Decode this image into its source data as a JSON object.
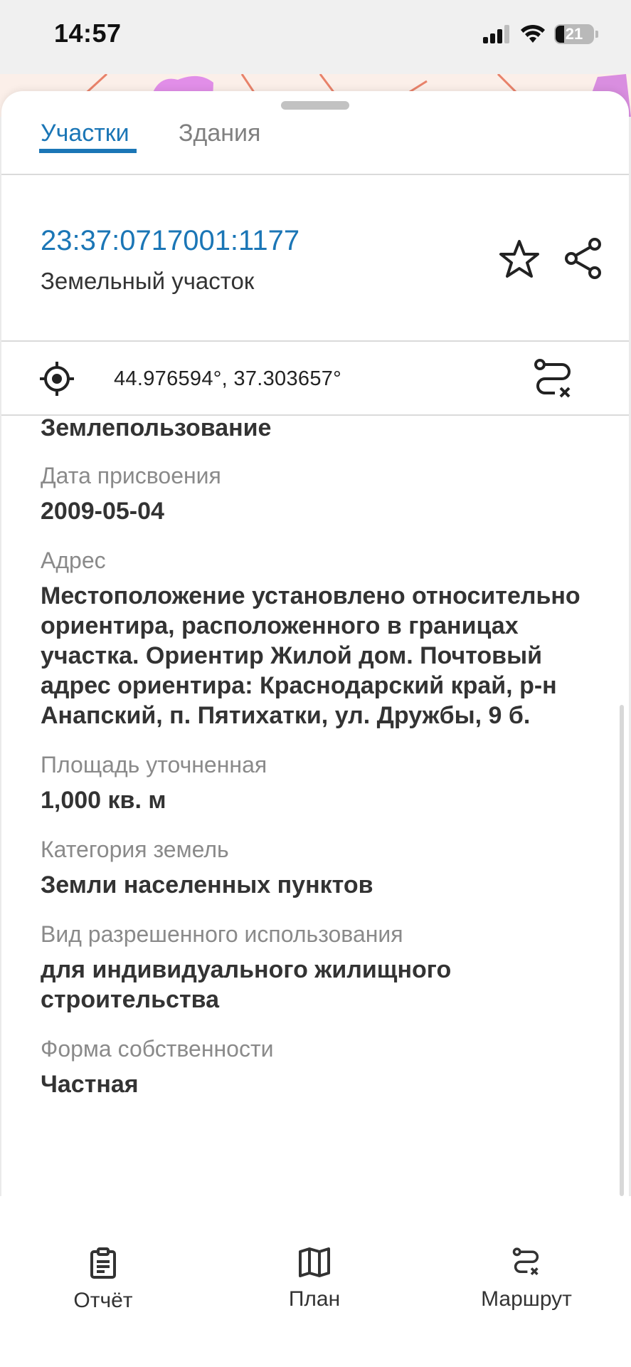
{
  "status_bar": {
    "time": "14:57",
    "battery": "21"
  },
  "tabs": [
    {
      "label": "Участки",
      "active": true
    },
    {
      "label": "Здания",
      "active": false
    }
  ],
  "parcel": {
    "cadastral_number": "23:37:0717001:1177",
    "type": "Земельный участок"
  },
  "coordinates": "44.976594°, 37.303657°",
  "details": [
    {
      "label": "",
      "value": "Землепользование"
    },
    {
      "label": "Дата присвоения",
      "value": "2009-05-04"
    },
    {
      "label": "Адрес",
      "value": "Местоположение установлено относительно ориентира, расположенного в границах участка. Ориентир Жилой дом. Почтовый адрес ориентира: Краснодарский край, р-н Анапский, п. Пятихатки, ул. Дружбы, 9 б."
    },
    {
      "label": "Площадь уточненная",
      "value": "1,000 кв. м"
    },
    {
      "label": "Категория земель",
      "value": "Земли населенных пунктов"
    },
    {
      "label": "Вид разрешенного использования",
      "value": "для индивидуального жилищного строительства"
    },
    {
      "label": "Форма собственности",
      "value": "Частная"
    }
  ],
  "bottom_nav": [
    {
      "label": "Отчёт",
      "icon": "clipboard-icon"
    },
    {
      "label": "План",
      "icon": "map-icon"
    },
    {
      "label": "Маршрут",
      "icon": "route-icon"
    }
  ],
  "colors": {
    "accent": "#1b76b6",
    "label_gray": "#8a8a8a",
    "map_pink": "#e18ee8",
    "map_line": "#e8826a"
  }
}
